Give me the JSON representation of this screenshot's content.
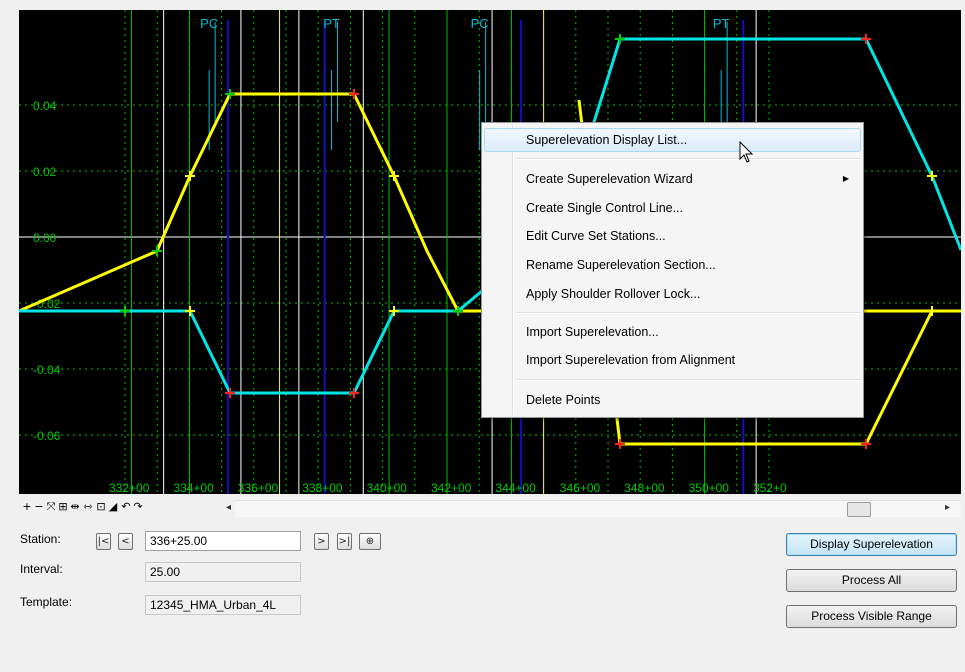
{
  "chart": {
    "y_ticks": [
      "0.04",
      "0.02",
      "0.00",
      "-0.02",
      "-0.04",
      "-0.06"
    ],
    "x_ticks": [
      "332+00",
      "334+00",
      "336+00",
      "338+00",
      "340+00",
      "342+00",
      "344+00",
      "346+00",
      "348+00",
      "350+00",
      "352+0"
    ],
    "curve_labels": [
      "PC",
      "PT",
      "PC",
      "PT"
    ],
    "colors": {
      "background": "#000000",
      "grid": "#00c000",
      "yellow_line": "#ffff00",
      "cyan_line": "#00e5e5",
      "blue_marker": "#1010c0",
      "pc_pt_lines": "#ffff00",
      "white_lines": "#ffffff",
      "point_green": "#00cc00",
      "point_red": "#ff2020"
    }
  },
  "toolbar": {
    "icons": [
      "zoom-in-icon",
      "zoom-out-icon",
      "pan-icon",
      "fit-icon",
      "zoom-horizontal-icon",
      "zoom-vertical-icon",
      "window-icon",
      "ruler-icon",
      "undo-icon",
      "redo-icon"
    ],
    "glyphs": [
      "+",
      "−",
      "⤧",
      "⊞",
      "⇹",
      "⇿",
      "⊡",
      "◢",
      "↶",
      "↷"
    ]
  },
  "form": {
    "station_label": "Station:",
    "station_value": "336+25.00",
    "interval_label": "Interval:",
    "interval_value": "25.00",
    "template_label": "Template:",
    "template_value": "12345_HMA_Urban_4L",
    "nav_first": "|<",
    "nav_prev": "<",
    "nav_next": ">",
    "nav_last": ">|",
    "nav_pick": "⊕"
  },
  "buttons": {
    "display": "Display  Superelevation",
    "process_all": "Process All",
    "process_visible": "Process Visible Range"
  },
  "menu": {
    "items": [
      "Superelevation Display List...",
      "Create Superelevation Wizard",
      "Create Single Control Line...",
      "Edit Curve Set Stations...",
      "Rename Superelevation Section...",
      "Apply Shoulder Rollover Lock...",
      "Import Superelevation...",
      "Import Superelevation from Alignment",
      "Delete Points"
    ],
    "submenu_arrow": "▶"
  }
}
